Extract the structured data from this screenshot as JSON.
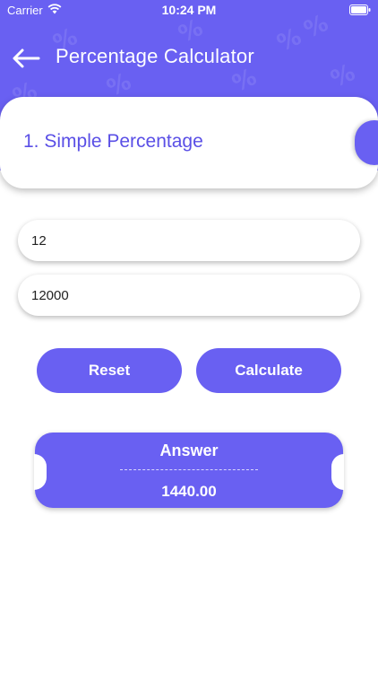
{
  "status_bar": {
    "carrier": "Carrier",
    "time": "10:24 PM"
  },
  "header": {
    "title": "Percentage Calculator",
    "background_color": "#6960f2",
    "decor_glyph": "%"
  },
  "mode": {
    "label": "1.  Simple Percentage"
  },
  "inputs": {
    "percent_value": "12",
    "amount_value": "12000"
  },
  "buttons": {
    "reset_label": "Reset",
    "calculate_label": "Calculate"
  },
  "answer": {
    "title": "Answer",
    "value": "1440.00"
  },
  "icons": {
    "back": "back-arrow-icon",
    "wifi": "wifi-icon",
    "battery": "battery-icon"
  },
  "colors": {
    "accent": "#6960f2",
    "accent_text": "#5a4fe6"
  }
}
